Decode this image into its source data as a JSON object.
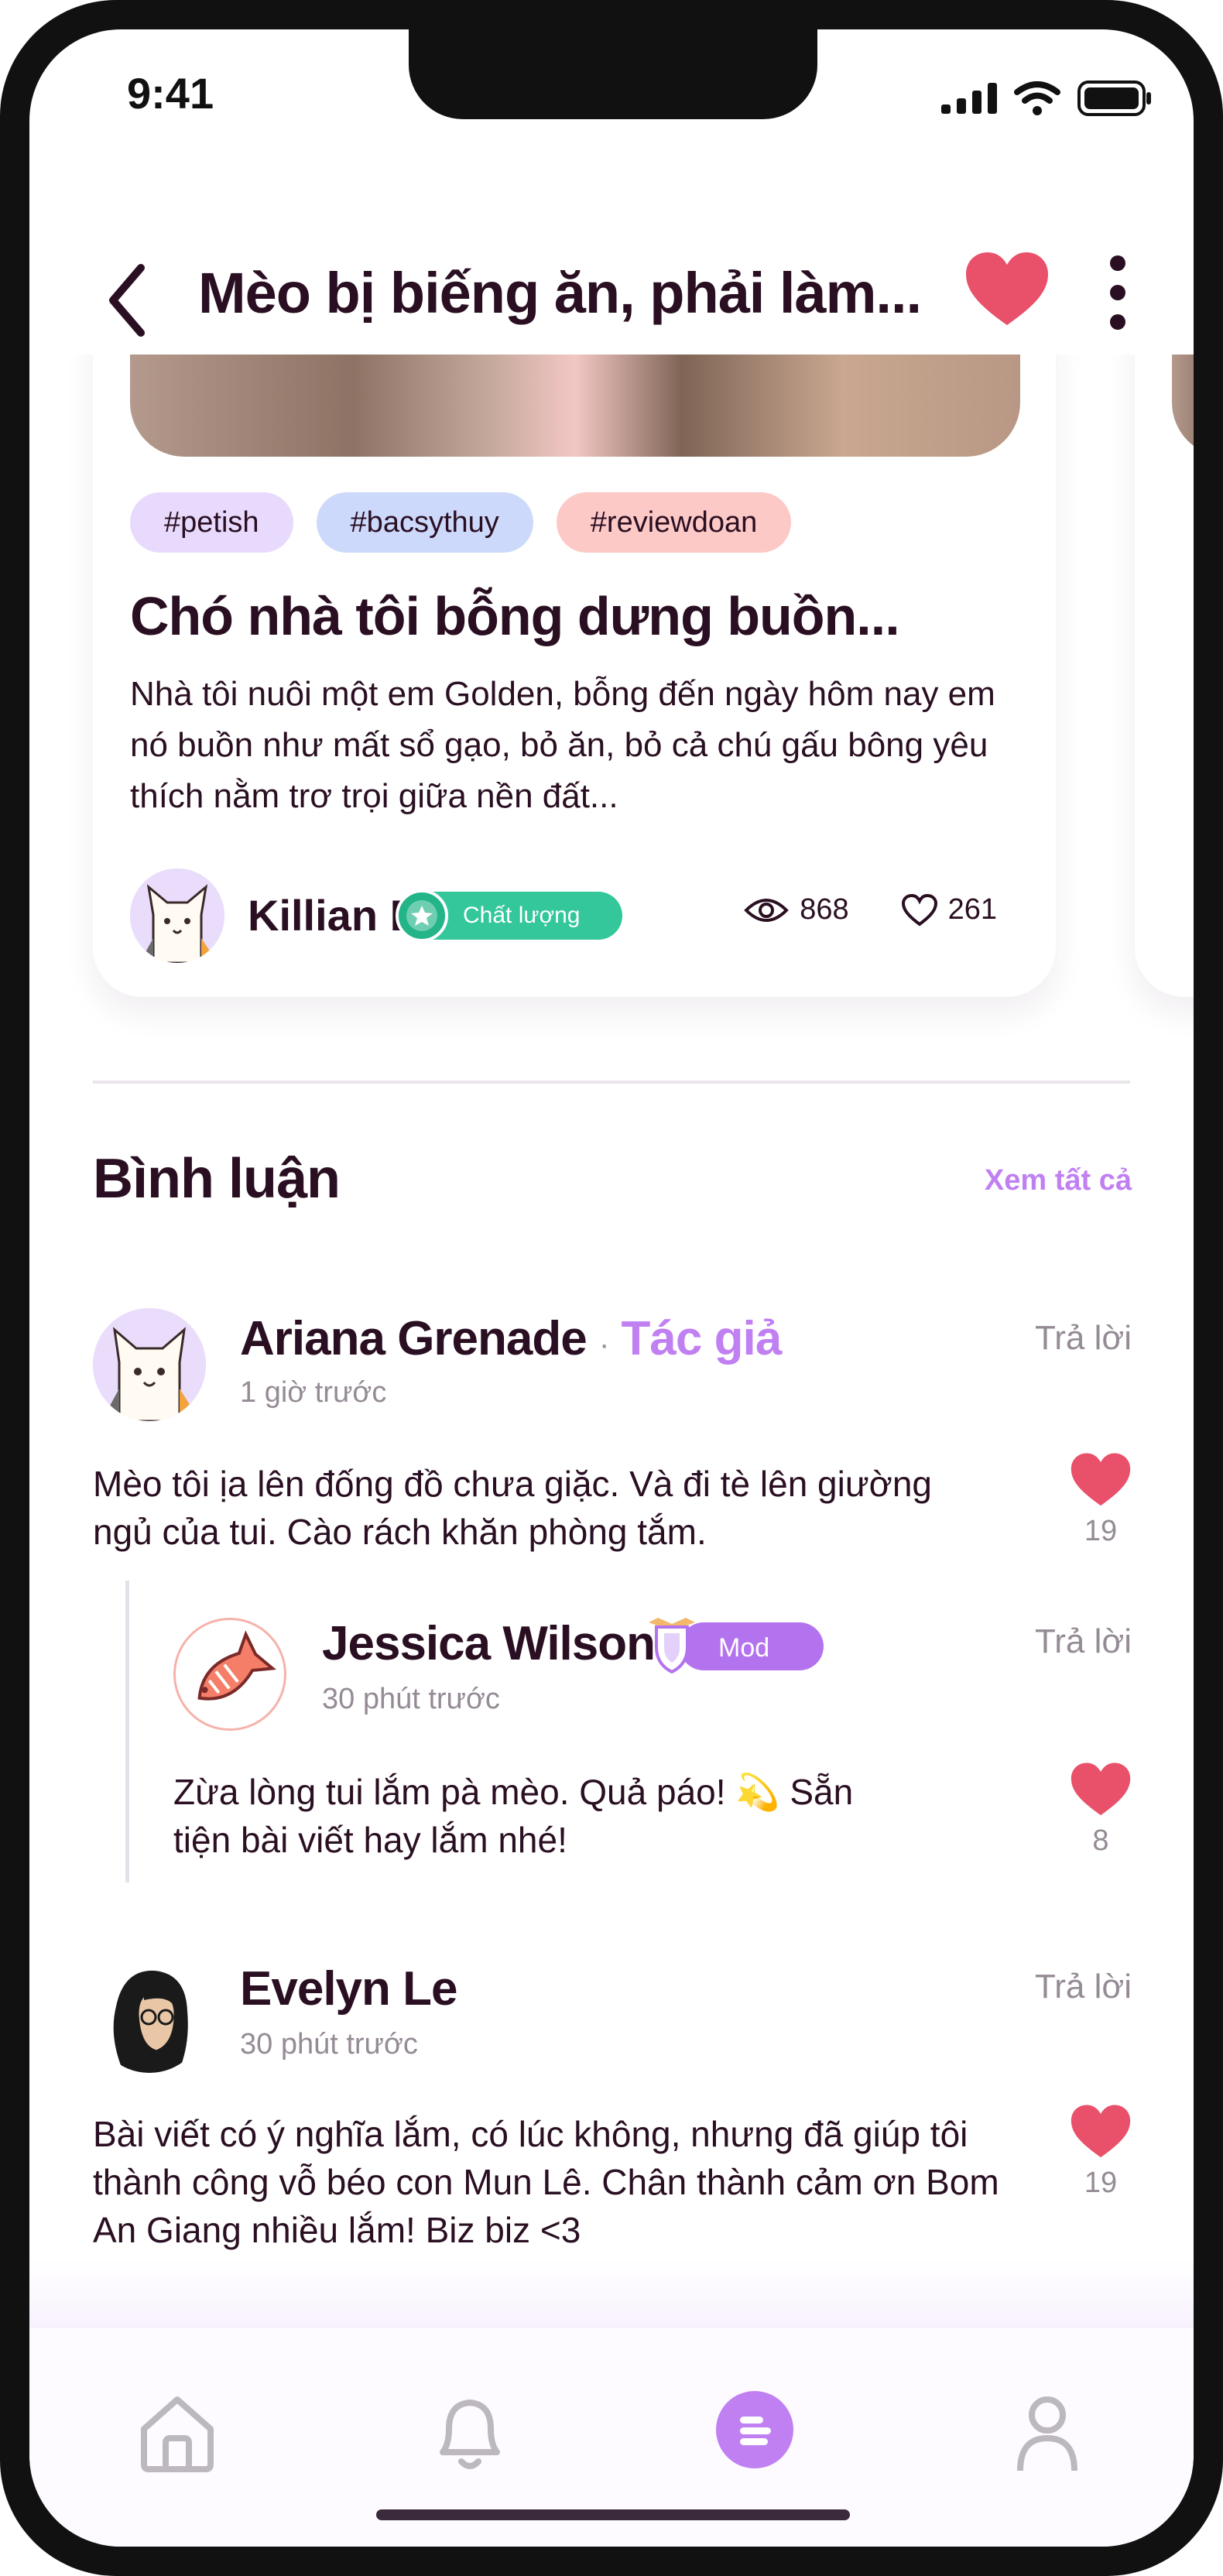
{
  "status": {
    "time": "9:41"
  },
  "header": {
    "title": "Mèo bị biếng ăn, phải làm..."
  },
  "post": {
    "tags": [
      "#petish",
      "#bacsythuy",
      "#reviewdoan"
    ],
    "title": "Chó nhà tôi bỗng dưng buồn...",
    "excerpt": "Nhà tôi nuôi một em Golden, bỗng đến ngày hôm nay em nó buồn như mất sổ gạo, bỏ ăn, bỏ cả chú gấu bông yêu thích nằm trơ trọi giữa nền đất...",
    "author": "Killian Doge",
    "quality_badge": "Chất lượng",
    "views": "868",
    "likes": "261"
  },
  "comments_section": {
    "title": "Bình luận",
    "see_all": "Xem tất cả"
  },
  "comments": [
    {
      "name": "Ariana Grenade",
      "separator": "·",
      "role": "Tác giả",
      "time": "1 giờ trước",
      "reply": "Trả lời",
      "text": "Mèo tôi ịa lên đống đồ chưa giặc. Và đi tè lên giường ngủ của tui. Cào rách khăn phòng tắm.",
      "likes": "19"
    },
    {
      "name": "Jessica Wilson",
      "role_badge": "Mod",
      "time": "30 phút trước",
      "reply": "Trả lời",
      "text": "Zừa lòng tui lắm pà mèo. Quả páo! 💫 Sẵn tiện bài viết hay lắm nhé!",
      "likes": "8"
    },
    {
      "name": "Evelyn Le",
      "time": "30 phút trước",
      "reply": "Trả lời",
      "text": "Bài viết có ý nghĩa lắm, có lúc không, nhưng đã giúp tôi thành công vỗ béo con Mun Lê. Chân thành cảm ơn Bom An Giang nhiều lắm! Biz biz <3",
      "likes": "19"
    }
  ],
  "colors": {
    "accent": "#c080f2",
    "heart": "#e9506a",
    "quality": "#33c79b",
    "text": "#2a0f22"
  },
  "icons": [
    "back-arrow-icon",
    "heart-icon",
    "more-vertical-icon",
    "eye-icon",
    "heart-outline-icon",
    "home-icon",
    "bell-icon",
    "feed-icon",
    "profile-icon"
  ]
}
